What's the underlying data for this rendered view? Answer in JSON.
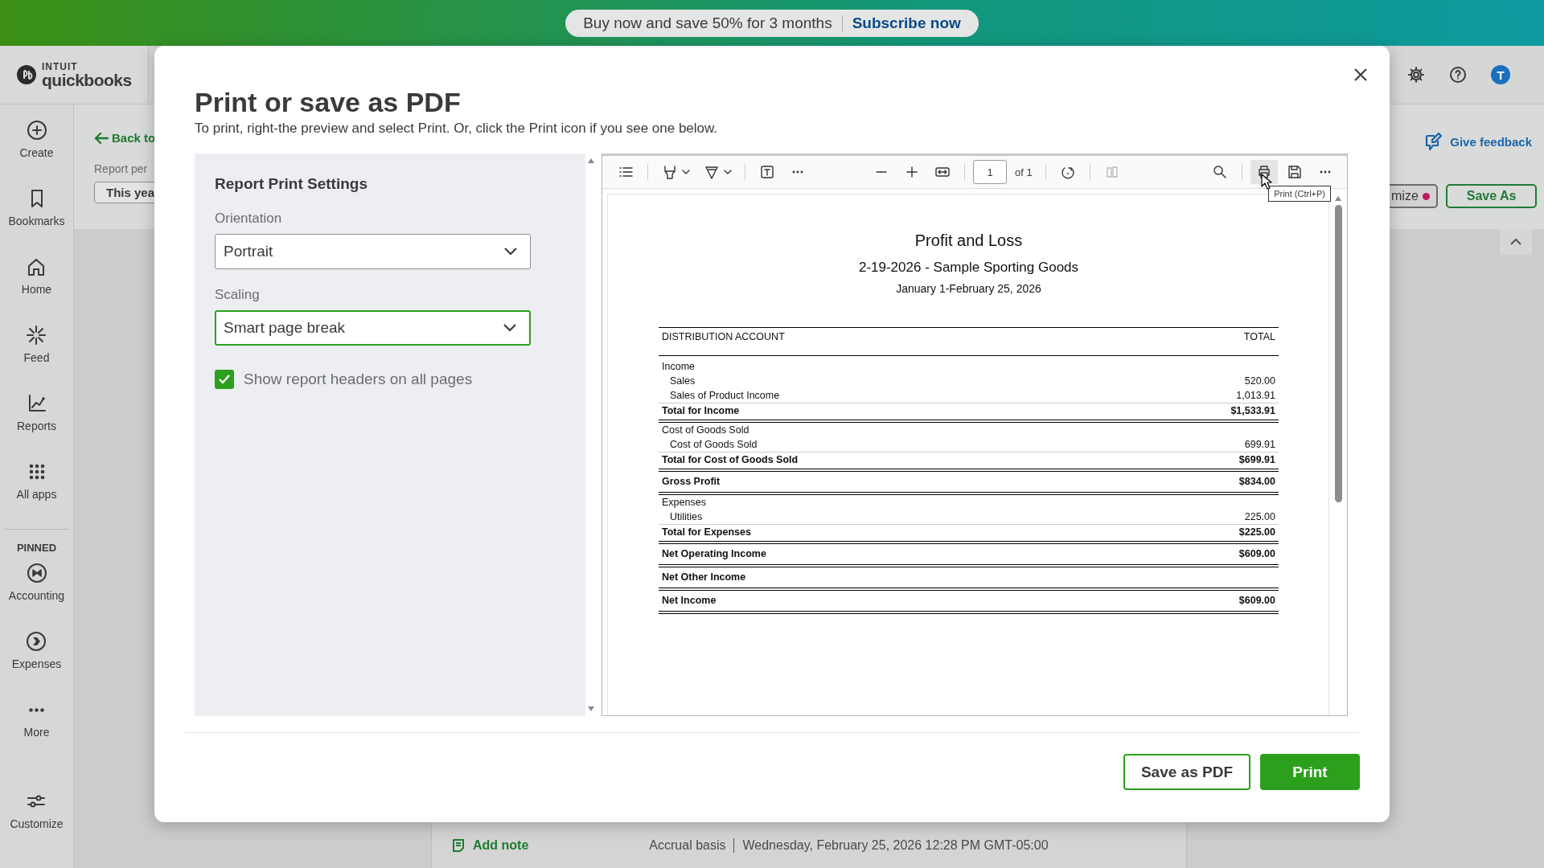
{
  "promo_banner": {
    "text": "Buy now and save 50% for 3 months",
    "link": "Subscribe now"
  },
  "logo": {
    "brand": "INTUIT",
    "product": "quickbooks"
  },
  "header": {
    "avatar": "T"
  },
  "nav": {
    "items": [
      {
        "label": "Create"
      },
      {
        "label": "Bookmarks"
      },
      {
        "label": "Home"
      },
      {
        "label": "Feed"
      },
      {
        "label": "Reports"
      },
      {
        "label": "All apps"
      }
    ],
    "pinned_label": "PINNED",
    "pinned": [
      {
        "label": "Accounting"
      },
      {
        "label": "Expenses"
      },
      {
        "label": "More"
      }
    ],
    "customize": "Customize"
  },
  "report_page": {
    "back_link": "Back to",
    "period_label": "Report per",
    "period_button": "This yea",
    "give_feedback": "Give feedback",
    "customize_button": "mize",
    "save_as": "Save As",
    "footer": {
      "add_note": "Add note",
      "basis": "Accrual basis",
      "timestamp": "Wednesday, February 25, 2026 12:28 PM GMT-05:00"
    }
  },
  "dialog": {
    "title": "Print or save as PDF",
    "instructions": "To print, right-the preview and select Print. Or, click the Print icon if you see one below.",
    "settings": {
      "heading": "Report Print Settings",
      "fields": [
        {
          "label": "Orientation",
          "value": "Portrait",
          "focused": false
        },
        {
          "label": "Scaling",
          "value": "Smart page break",
          "focused": true
        }
      ],
      "checkbox": {
        "label": "Show report headers on all pages",
        "checked": true
      }
    },
    "viewer": {
      "page": "1",
      "page_count": "of 1",
      "tooltip": "Print (Ctrl+P)",
      "report": {
        "title": "Profit and Loss",
        "company": "2-19-2026 - Sample Sporting Goods",
        "dates": "January 1-February 25, 2026",
        "columns": [
          "DISTRIBUTION ACCOUNT",
          "TOTAL"
        ],
        "rows": [
          {
            "kind": "group",
            "label": "Income"
          },
          {
            "kind": "line",
            "label": "Sales",
            "value": "520.00"
          },
          {
            "kind": "line",
            "label": "Sales of Product Income",
            "value": "1,013.91"
          },
          {
            "kind": "total",
            "label": "Total for Income",
            "value": "$1,533.91"
          },
          {
            "kind": "group",
            "label": "Cost of Goods Sold"
          },
          {
            "kind": "line",
            "label": "Cost of Goods Sold",
            "value": "699.91"
          },
          {
            "kind": "total",
            "label": "Total for Cost of Goods Sold",
            "value": "$699.91"
          },
          {
            "kind": "summary",
            "label": "Gross Profit",
            "value": "$834.00"
          },
          {
            "kind": "group",
            "label": "Expenses"
          },
          {
            "kind": "line",
            "label": "Utilities",
            "value": "225.00"
          },
          {
            "kind": "total",
            "label": "Total for Expenses",
            "value": "$225.00"
          },
          {
            "kind": "summary",
            "label": "Net Operating Income",
            "value": "$609.00"
          },
          {
            "kind": "summary",
            "label": "Net Other Income"
          },
          {
            "kind": "summary",
            "label": "Net Income",
            "value": "$609.00"
          }
        ]
      }
    },
    "buttons": [
      {
        "label": "Save as PDF",
        "kind": "secondary"
      },
      {
        "label": "Print",
        "kind": "primary"
      }
    ]
  }
}
